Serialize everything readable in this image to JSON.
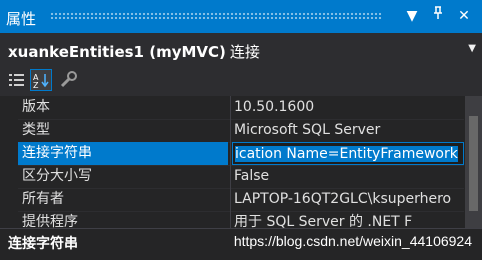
{
  "window": {
    "title": "属性"
  },
  "object": {
    "name": "xuankeEntities1 (myMVC)",
    "type": "连接"
  },
  "toolbar": {
    "icons": [
      "categorized-icon",
      "alphabetical-icon",
      "properties-wrench-icon"
    ]
  },
  "properties": [
    {
      "name": "版本",
      "value": "10.50.1600"
    },
    {
      "name": "类型",
      "value": "Microsoft SQL Server"
    },
    {
      "name": "连接字符串",
      "value": "ication Name=EntityFramework",
      "selected": true
    },
    {
      "name": "区分大小写",
      "value": "False"
    },
    {
      "name": "所有者",
      "value": "LAPTOP-16QT2GLC\\ksuperhero"
    },
    {
      "name": "提供程序",
      "value": "用于 SQL Server 的 .NET F"
    }
  ],
  "description": {
    "title": "连接字符串"
  },
  "watermark": "https://blog.csdn.net/weixin_44106924"
}
